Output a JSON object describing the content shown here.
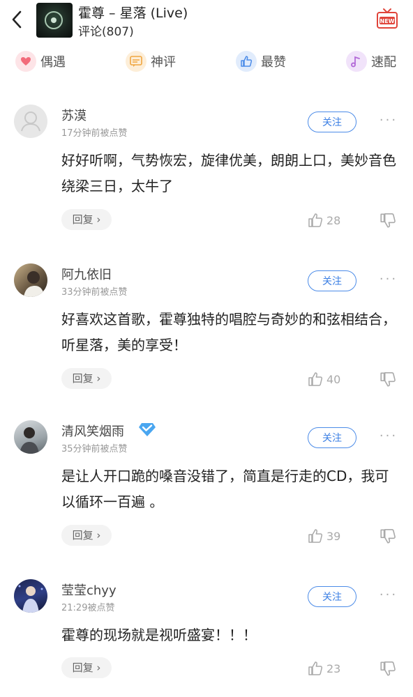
{
  "header": {
    "title": "霍尊 – 星落 (Live)",
    "comment_count": "评论(807)",
    "back_icon": "back-arrow-icon",
    "badge_icon": "new-badge-icon",
    "badge_text": "NEW"
  },
  "tabs": [
    {
      "label": "偶遇",
      "icon": "heart-icon",
      "color": "#f26b7a"
    },
    {
      "label": "神评",
      "icon": "message-icon",
      "color": "#f0a640"
    },
    {
      "label": "最赞",
      "icon": "thumbs-up-icon",
      "color": "#4b8be8"
    },
    {
      "label": "速配",
      "icon": "music-note-icon",
      "color": "#b36ad8"
    }
  ],
  "comments": [
    {
      "user": "苏漠",
      "time": "17分钟前被点赞",
      "follow_label": "关注",
      "text": "好好听啊，气势恢宏，旋律优美，朗朗上口，美妙音色绕梁三日，太牛了",
      "reply_label": "回复",
      "likes": "28",
      "verified": false
    },
    {
      "user": "阿九依旧",
      "time": "33分钟前被点赞",
      "follow_label": "关注",
      "text": "好喜欢这首歌，霍尊独特的唱腔与奇妙的和弦相结合，听星落，美的享受！",
      "reply_label": "回复",
      "likes": "40",
      "verified": false
    },
    {
      "user": "清风笑烟雨",
      "time": "35分钟前被点赞",
      "follow_label": "关注",
      "text": "是让人开口跪的嗓音没错了，简直是行走的CD，我可以循环一百遍 。",
      "reply_label": "回复",
      "likes": "39",
      "verified": true
    },
    {
      "user": "莹莹chyy",
      "time": "21:29被点赞",
      "follow_label": "关注",
      "text": "霍尊的现场就是视听盛宴！！！",
      "reply_label": "回复",
      "likes": "23",
      "verified": false
    }
  ],
  "colors": {
    "accent_blue": "#4b8be8",
    "muted_gray": "#999999"
  }
}
